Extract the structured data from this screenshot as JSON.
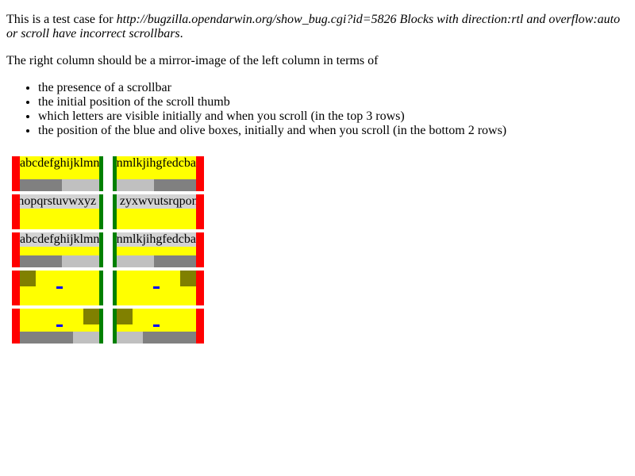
{
  "intro": {
    "prefix": "This is a test case for ",
    "link_italic": "http://bugzilla.opendarwin.org/show_bug.cgi?id=5826 Blocks with direction:rtl and overflow:auto or scroll have incorrect scrollbars",
    "suffix": "."
  },
  "description": "The right column should be a mirror-image of the left column in terms of",
  "bullets": [
    "the presence of a scrollbar",
    "the initial position of the scroll thumb",
    "which letters are visible initially and when you scroll (in the top 3 rows)",
    "the position of the blue and olive boxes, initially and when you scroll (in the bottom 2 rows)"
  ],
  "rows": {
    "ltr_text": "abcdefghijklmnopqrstuvwxyz",
    "rtl_text": "zyxwvutsrqponmlkjihgfedcba"
  },
  "colors": {
    "red": "#ff0000",
    "green": "#008000",
    "yellow": "#ffff00",
    "olive": "#808000",
    "blue": "#0000ff",
    "thumb": "#808080",
    "track": "#c0c0c0",
    "textbg": "#d3d3d3"
  }
}
